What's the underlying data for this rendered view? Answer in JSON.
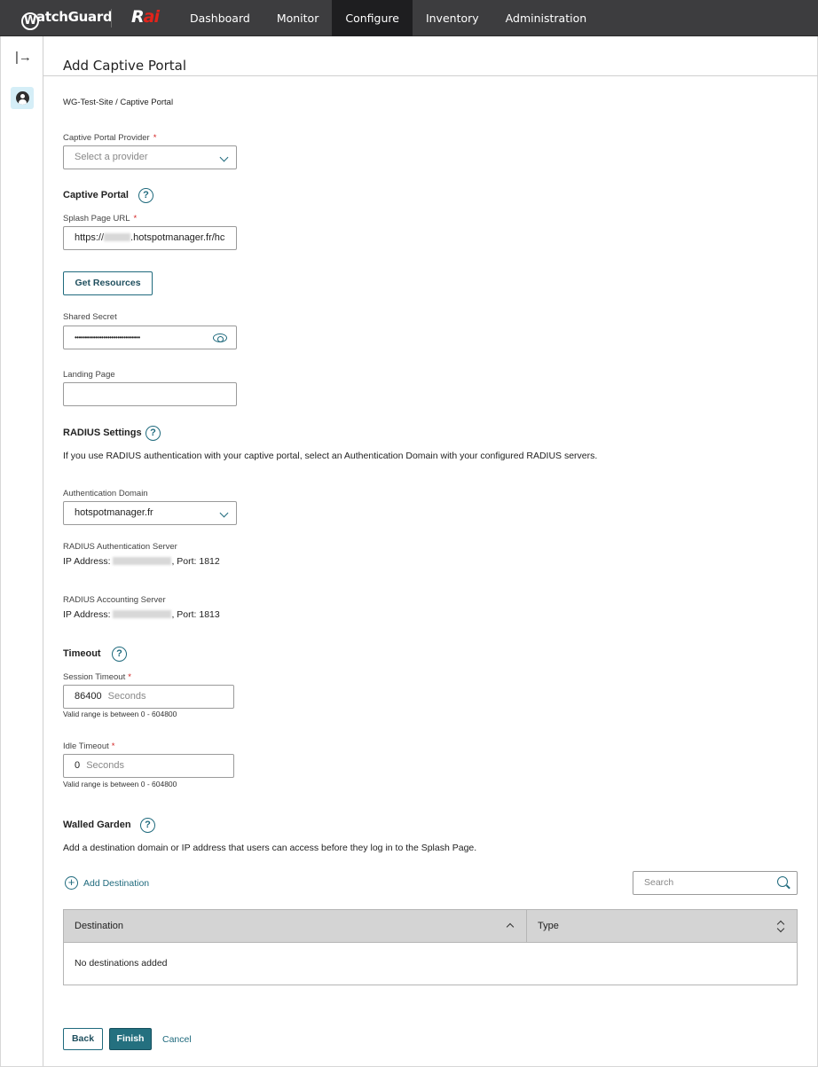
{
  "header": {
    "logo_text": "WatchGuard",
    "logo_letter": "W",
    "logo_rest": "atchGuard",
    "rai_r": "R",
    "rai_ai": "ai",
    "nav": [
      {
        "label": "Dashboard"
      },
      {
        "label": "Monitor"
      },
      {
        "label": "Configure",
        "active": true
      },
      {
        "label": "Inventory"
      },
      {
        "label": "Administration"
      }
    ]
  },
  "sidebar": {
    "expand_glyph": "|→"
  },
  "page": {
    "title": "Add Captive Portal",
    "breadcrumb": "WG-Test-Site / Captive Portal"
  },
  "provider": {
    "label": "Captive Portal Provider",
    "required": "*",
    "placeholder": "Select a provider"
  },
  "captive_portal": {
    "heading": "Captive Portal",
    "help": "?",
    "splash_label": "Splash Page URL",
    "splash_prefix": "https://",
    "splash_suffix": ".hotspotmanager.fr/hc",
    "get_resources": "Get Resources",
    "secret_label": "Shared Secret",
    "secret_value": "••••••••••••••••••••••••••••••••",
    "landing_label": "Landing Page",
    "landing_value": ""
  },
  "radius": {
    "heading": "RADIUS Settings",
    "help": "?",
    "description": "If you use RADIUS authentication with your captive portal, select an Authentication Domain with your configured RADIUS servers.",
    "domain_label": "Authentication Domain",
    "domain_value": "hotspotmanager.fr",
    "auth_server_label": "RADIUS Authentication Server",
    "auth_ip_prefix": "IP Address:",
    "auth_port": ", Port: 1812",
    "acct_server_label": "RADIUS Accounting Server",
    "acct_ip_prefix": "IP Address:",
    "acct_port": ", Port: 1813"
  },
  "timeout": {
    "heading": "Timeout",
    "help": "?",
    "session_label": "Session Timeout",
    "session_value": "86400",
    "session_unit": "Seconds",
    "session_hint": "Valid range is between 0 - 604800",
    "idle_label": "Idle Timeout",
    "idle_value": "0",
    "idle_unit": "Seconds",
    "idle_hint": "Valid range is between 0 - 604800",
    "required": "*"
  },
  "walled_garden": {
    "heading": "Walled Garden",
    "help": "?",
    "description": "Add a destination domain or IP address that users can access before they log in to the Splash Page.",
    "add_label": "Add Destination",
    "search_placeholder": "Search",
    "columns": [
      "Destination",
      "Type"
    ],
    "empty_text": "No destinations added"
  },
  "footer": {
    "back": "Back",
    "finish": "Finish",
    "cancel": "Cancel"
  },
  "colors": {
    "accent": "#1f6a7d",
    "topbar": "#3d3d3f",
    "active_nav": "#1e1e20",
    "required": "#d21f1f"
  }
}
